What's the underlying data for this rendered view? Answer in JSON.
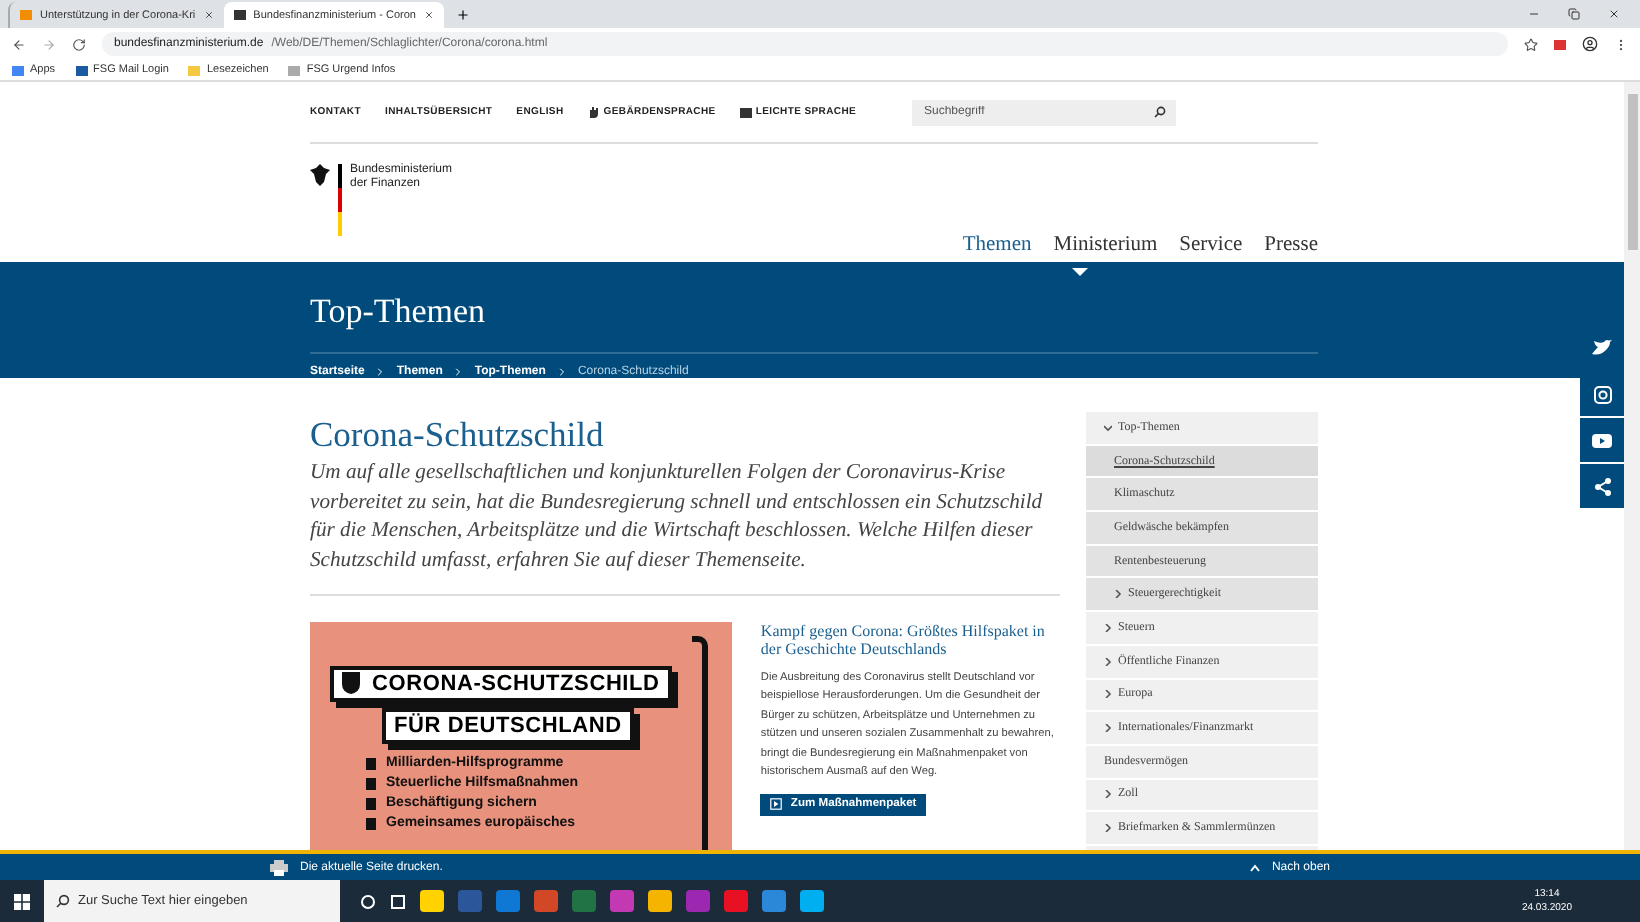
{
  "browser": {
    "tabs": [
      {
        "title": "Unterstützung in der Corona-Kri",
        "selected": false
      },
      {
        "title": "Bundesfinanzministerium - Coron",
        "selected": true
      }
    ],
    "url_host": "bundesfinanzministerium.de",
    "url_path": "/Web/DE/Themen/Schlaglichter/Corona/corona.html",
    "bookmarks": [
      {
        "label": "Apps",
        "kind": "apps"
      },
      {
        "label": "FSG Mail Login",
        "kind": "flag"
      },
      {
        "label": "Lesezeichen",
        "kind": "folder"
      },
      {
        "label": "FSG Urgend Infos",
        "kind": "page"
      }
    ]
  },
  "site": {
    "top_links": [
      {
        "label": "KONTAKT",
        "kind": "plain"
      },
      {
        "label": "INHALTSÜBERSICHT",
        "kind": "plain"
      },
      {
        "label": "ENGLISH",
        "kind": "plain"
      },
      {
        "label": "GEBÄRDENSPRACHE",
        "kind": "sign"
      },
      {
        "label": "LEICHTE SPRACHE",
        "kind": "easy"
      }
    ],
    "search": {
      "placeholder": "Suchbegriff"
    },
    "logo_text": [
      "Bundesministerium",
      "der Finanzen"
    ],
    "nav": [
      {
        "label": "Themen",
        "selected": true
      },
      {
        "label": "Ministerium",
        "selected": false
      },
      {
        "label": "Service",
        "selected": false
      },
      {
        "label": "Presse",
        "selected": false
      }
    ],
    "banner_title": "Top-Themen",
    "breadcrumb": [
      {
        "label": "Startseite",
        "current": false
      },
      {
        "label": "Themen",
        "current": false
      },
      {
        "label": "Top-Themen",
        "current": false
      },
      {
        "label": "Corona-Schutzschild",
        "current": true
      }
    ]
  },
  "article": {
    "title": "Corona-Schutzschild",
    "intro": "Um auf alle gesellschaftlichen und konjunkturellen Folgen der Coronavirus-Krise vorbereitet zu sein, hat die Bundesregierung schnell und entschlossen ein Schutzschild für die Menschen, Arbeitsplätze und die Wirtschaft beschlossen. Welche Hilfen dieser Schutzschild umfasst, erfahren Sie auf dieser Themenseite.",
    "graphic": {
      "title_lines": [
        "CORONA-SCHUTZSCHILD",
        "FÜR DEUTSCHLAND"
      ],
      "bullets": [
        "Milliarden-Hilfsprogramme",
        "Steuerliche Hilfsmaßnahmen",
        "Beschäftigung sichern",
        "Gemeinsames europäisches"
      ]
    },
    "teaser": {
      "title": "Kampf gegen Corona: Größtes Hilfspaket in der Geschichte Deutschlands",
      "text": "Die Ausbreitung des Coronavirus stellt Deutschland vor beispiellose Herausforderungen. Um die Gesundheit der Bürger zu schützen, Arbeitsplätze und Unternehmen zu stützen und unseren sozialen Zusammenhalt zu bewahren, bringt die Bundesregierung ein Maßnahmenpaket von historischem Ausmaß auf den Weg.",
      "button": "Zum Maßnahmenpaket"
    }
  },
  "sidebar": {
    "items": [
      {
        "label": "Top-Themen",
        "expandable": true,
        "expanded": true,
        "selected": false,
        "children": [
          {
            "label": "Corona-Schutzschild",
            "expandable": false,
            "expanded": false,
            "selected": true
          },
          {
            "label": "Klimaschutz",
            "expandable": false,
            "expanded": false,
            "selected": false
          },
          {
            "label": "Geldwäsche bekämpfen",
            "expandable": false,
            "expanded": false,
            "selected": false
          },
          {
            "label": "Rentenbesteuerung",
            "expandable": false,
            "expanded": false,
            "selected": false
          },
          {
            "label": "Steuergerechtigkeit",
            "expandable": true,
            "expanded": false,
            "selected": false
          }
        ]
      },
      {
        "label": "Steuern",
        "expandable": true,
        "expanded": false,
        "selected": false
      },
      {
        "label": "Öffentliche Finanzen",
        "expandable": true,
        "expanded": false,
        "selected": false
      },
      {
        "label": "Europa",
        "expandable": true,
        "expanded": false,
        "selected": false
      },
      {
        "label": "Internationales/Finanzmarkt",
        "expandable": true,
        "expanded": false,
        "selected": false
      },
      {
        "label": "Bundesvermögen",
        "expandable": false,
        "expanded": false,
        "selected": false
      },
      {
        "label": "Zoll",
        "expandable": true,
        "expanded": false,
        "selected": false
      },
      {
        "label": "Briefmarken & Sammlermünzen",
        "expandable": true,
        "expanded": false,
        "selected": false
      }
    ]
  },
  "print_bar": {
    "print": "Die aktuelle Seite drucken.",
    "top": "Nach oben"
  },
  "taskbar": {
    "search_placeholder": "Zur Suche Text hier eingeben",
    "time": "13:14",
    "date": "24.03.2020"
  }
}
